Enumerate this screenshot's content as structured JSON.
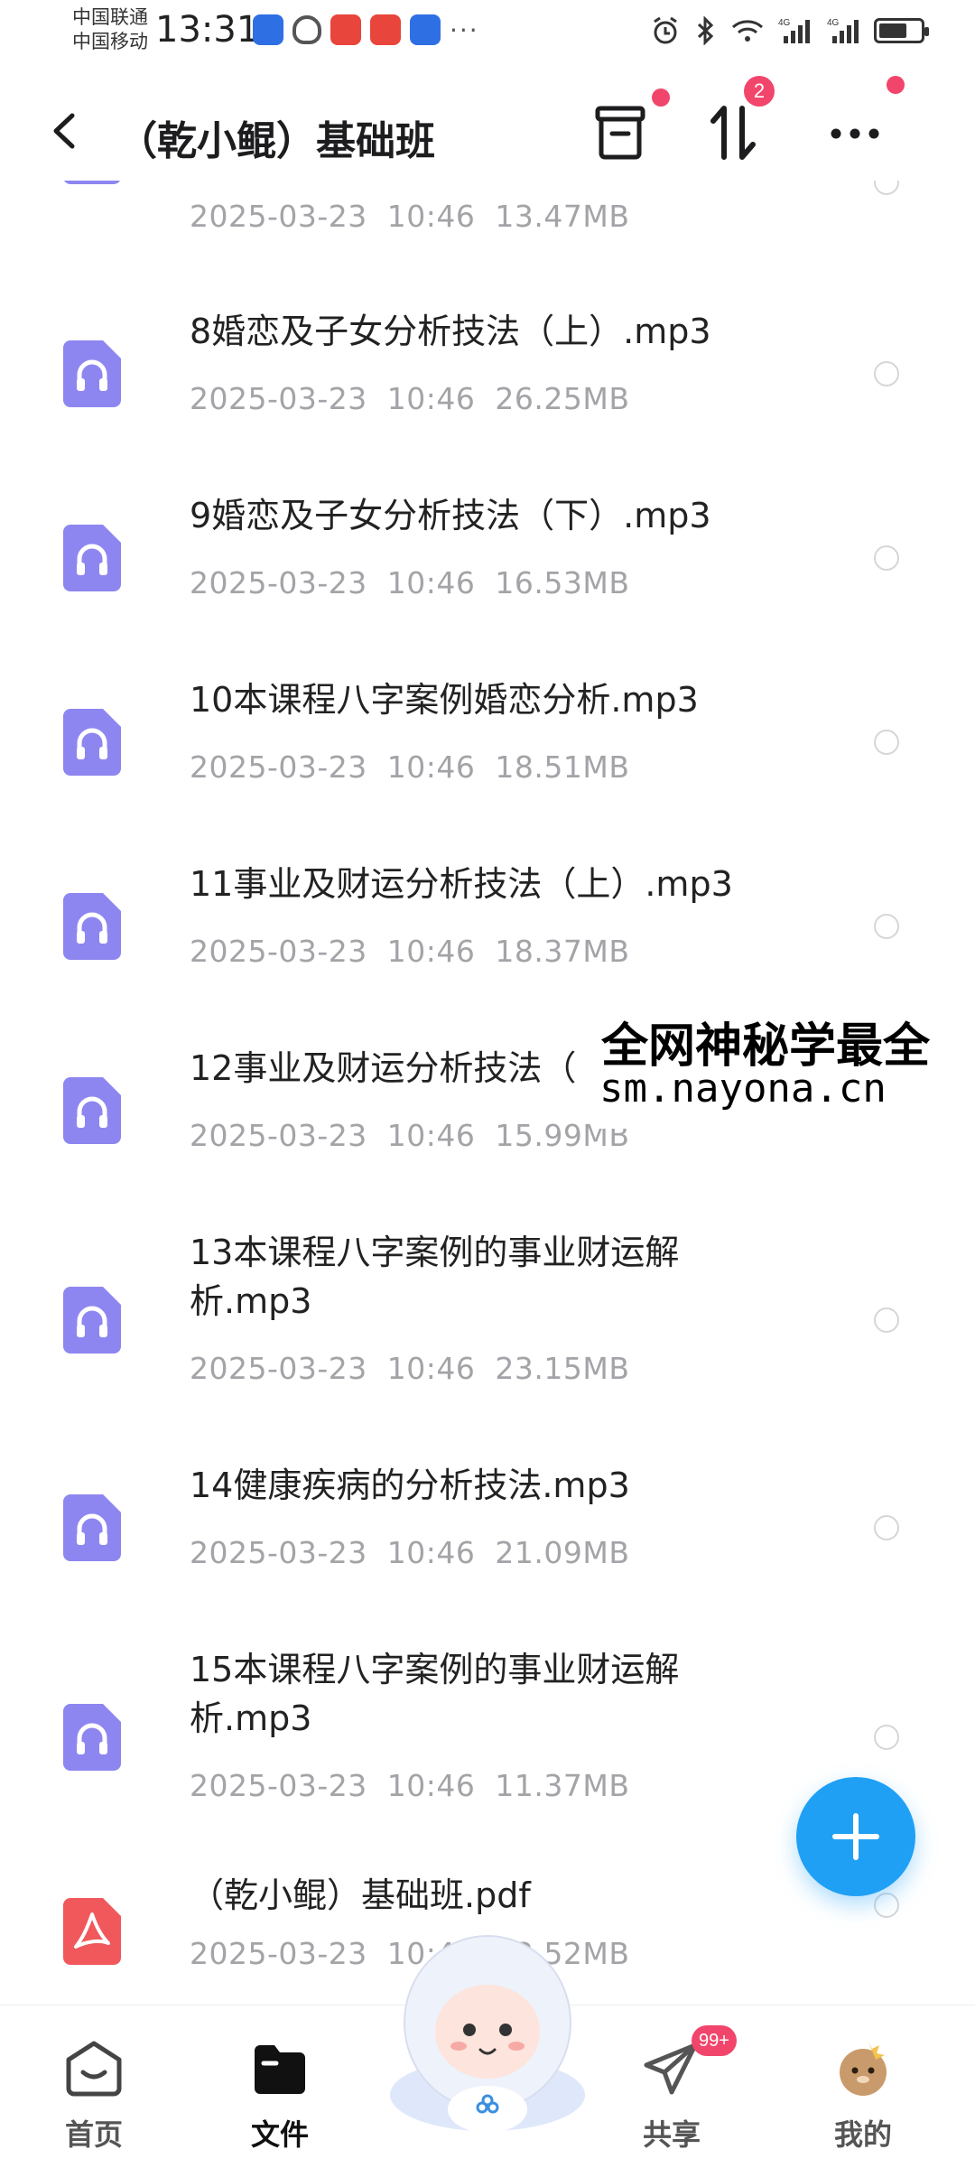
{
  "status_bar": {
    "carrier1": "中国联通",
    "carrier2": "中国移动",
    "time": "13:31",
    "net1": "4G",
    "net2": "4G"
  },
  "header": {
    "title": "（乾小鲲）基础班",
    "transfer_badge": "2"
  },
  "files": [
    {
      "name": "",
      "date": "2025-03-23",
      "time": "10:46",
      "size": "13.47MB",
      "type": "audio"
    },
    {
      "name": "8婚恋及子女分析技法（上）.mp3",
      "date": "2025-03-23",
      "time": "10:46",
      "size": "26.25MB",
      "type": "audio"
    },
    {
      "name": "9婚恋及子女分析技法（下）.mp3",
      "date": "2025-03-23",
      "time": "10:46",
      "size": "16.53MB",
      "type": "audio"
    },
    {
      "name": "10本课程八字案例婚恋分析.mp3",
      "date": "2025-03-23",
      "time": "10:46",
      "size": "18.51MB",
      "type": "audio"
    },
    {
      "name": "11事业及财运分析技法（上）.mp3",
      "date": "2025-03-23",
      "time": "10:46",
      "size": "18.37MB",
      "type": "audio"
    },
    {
      "name": "12事业及财运分析技法（",
      "date": "2025-03-23",
      "time": "10:46",
      "size": "15.99MB",
      "type": "audio"
    },
    {
      "name": "13本课程八字案例的事业财运解析.mp3",
      "date": "2025-03-23",
      "time": "10:46",
      "size": "23.15MB",
      "type": "audio"
    },
    {
      "name": "14健康疾病的分析技法.mp3",
      "date": "2025-03-23",
      "time": "10:46",
      "size": "21.09MB",
      "type": "audio"
    },
    {
      "name": "15本课程八字案例的事业财运解析.mp3",
      "date": "2025-03-23",
      "time": "10:46",
      "size": "11.37MB",
      "type": "audio"
    },
    {
      "name": "（乾小鲲）基础班.pdf",
      "date": "2025-03-23",
      "time": "10:46",
      "size": "23.52MB",
      "type": "pdf"
    }
  ],
  "watermark": {
    "line1": "全网神秘学最全",
    "line2": "sm.nayona.cn"
  },
  "bottom_nav": {
    "home": "首页",
    "files": "文件",
    "share": "共享",
    "share_badge": "99+",
    "mine": "我的"
  },
  "colors": {
    "audio_icon": "#8e86f0",
    "pdf_icon": "#f0585b",
    "fab": "#1fa0f5",
    "badge": "#f2456b"
  }
}
